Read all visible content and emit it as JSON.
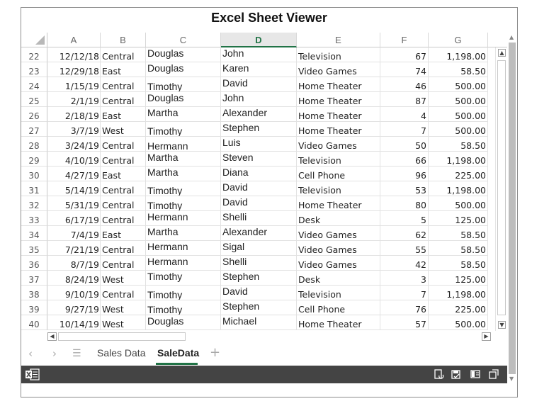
{
  "title": "Excel Sheet Viewer",
  "columns": [
    "A",
    "B",
    "C",
    "D",
    "E",
    "F",
    "G"
  ],
  "selected_column": "D",
  "rows": [
    {
      "n": "22",
      "a": "12/12/18",
      "b": "Central",
      "c": "Douglas",
      "d": "John",
      "e": "Television",
      "f": "67",
      "g": "1,198.00"
    },
    {
      "n": "23",
      "a": "12/29/18",
      "b": "East",
      "c": "Douglas",
      "d": "Karen",
      "e": "Video Games",
      "f": "74",
      "g": "58.50"
    },
    {
      "n": "24",
      "a": "1/15/19",
      "b": "Central",
      "c": "Timothy",
      "d": "David",
      "e": "Home Theater",
      "f": "46",
      "g": "500.00"
    },
    {
      "n": "25",
      "a": "2/1/19",
      "b": "Central",
      "c": "Douglas",
      "d": "John",
      "e": "Home Theater",
      "f": "87",
      "g": "500.00"
    },
    {
      "n": "26",
      "a": "2/18/19",
      "b": "East",
      "c": "Martha",
      "d": "Alexander",
      "e": "Home Theater",
      "f": "4",
      "g": "500.00"
    },
    {
      "n": "27",
      "a": "3/7/19",
      "b": "West",
      "c": "Timothy",
      "d": "Stephen",
      "e": "Home Theater",
      "f": "7",
      "g": "500.00"
    },
    {
      "n": "28",
      "a": "3/24/19",
      "b": "Central",
      "c": "Hermann",
      "d": "Luis",
      "e": "Video Games",
      "f": "50",
      "g": "58.50"
    },
    {
      "n": "29",
      "a": "4/10/19",
      "b": "Central",
      "c": "Martha",
      "d": "Steven",
      "e": "Television",
      "f": "66",
      "g": "1,198.00"
    },
    {
      "n": "30",
      "a": "4/27/19",
      "b": "East",
      "c": "Martha",
      "d": "Diana",
      "e": "Cell Phone",
      "f": "96",
      "g": "225.00"
    },
    {
      "n": "31",
      "a": "5/14/19",
      "b": "Central",
      "c": "Timothy",
      "d": "David",
      "e": "Television",
      "f": "53",
      "g": "1,198.00"
    },
    {
      "n": "32",
      "a": "5/31/19",
      "b": "Central",
      "c": "Timothy",
      "d": "David",
      "e": "Home Theater",
      "f": "80",
      "g": "500.00"
    },
    {
      "n": "33",
      "a": "6/17/19",
      "b": "Central",
      "c": "Hermann",
      "d": "Shelli",
      "e": "Desk",
      "f": "5",
      "g": "125.00"
    },
    {
      "n": "34",
      "a": "7/4/19",
      "b": "East",
      "c": "Martha",
      "d": "Alexander",
      "e": "Video Games",
      "f": "62",
      "g": "58.50"
    },
    {
      "n": "35",
      "a": "7/21/19",
      "b": "Central",
      "c": "Hermann",
      "d": "Sigal",
      "e": "Video Games",
      "f": "55",
      "g": "58.50"
    },
    {
      "n": "36",
      "a": "8/7/19",
      "b": "Central",
      "c": "Hermann",
      "d": "Shelli",
      "e": "Video Games",
      "f": "42",
      "g": "58.50"
    },
    {
      "n": "37",
      "a": "8/24/19",
      "b": "West",
      "c": "Timothy",
      "d": "Stephen",
      "e": "Desk",
      "f": "3",
      "g": "125.00"
    },
    {
      "n": "38",
      "a": "9/10/19",
      "b": "Central",
      "c": "Timothy",
      "d": "David",
      "e": "Television",
      "f": "7",
      "g": "1,198.00"
    },
    {
      "n": "39",
      "a": "9/27/19",
      "b": "West",
      "c": "Timothy",
      "d": "Stephen",
      "e": "Cell Phone",
      "f": "76",
      "g": "225.00"
    },
    {
      "n": "40",
      "a": "10/14/19",
      "b": "West",
      "c": "Douglas",
      "d": "Michael",
      "e": "Home Theater",
      "f": "57",
      "g": "500.00"
    }
  ],
  "sheet_tabs": [
    {
      "label": "Sales Data",
      "active": false
    },
    {
      "label": "SaleData",
      "active": true
    }
  ],
  "icons": {
    "nav_prev": "chevron-left-icon",
    "nav_next": "chevron-right-icon",
    "sheet_menu": "hamburger-menu-icon",
    "add_sheet": "plus-icon",
    "app": "excel-icon"
  },
  "colors": {
    "accent": "#217346",
    "statusbar": "#444444"
  }
}
